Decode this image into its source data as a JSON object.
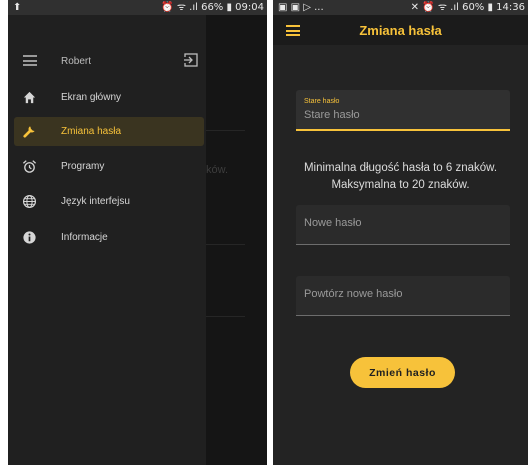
{
  "left_screen": {
    "status": {
      "left": "⬆",
      "right": "⏰ ᯤ .ıl 66% ▮ 09:04"
    },
    "drawer": {
      "user_name": "Robert",
      "items": [
        {
          "label": "Ekran główny",
          "icon": "home-icon",
          "active": false
        },
        {
          "label": "Zmiana hasła",
          "icon": "wrench-icon",
          "active": true
        },
        {
          "label": "Programy",
          "icon": "alarm-clock-icon",
          "active": false
        },
        {
          "label": "Język interfejsu",
          "icon": "globe-icon",
          "active": false
        },
        {
          "label": "Informacje",
          "icon": "info-icon",
          "active": false
        }
      ]
    },
    "behind_text": "ków."
  },
  "right_screen": {
    "status": {
      "left": "▣ ▣ ▷ ...",
      "right": "✕ ⏰ ᯤ .ıl 60% ▮ 14:36"
    },
    "title": "Zmiana hasła",
    "old_password": {
      "label": "Stare hasło",
      "placeholder": "Stare hasło"
    },
    "hint_line1": "Minimalna długość hasła to 6 znaków.",
    "hint_line2": "Maksymalna to 20 znaków.",
    "new_password": {
      "placeholder": "Nowe hasło"
    },
    "repeat_password": {
      "placeholder": "Powtórz nowe hasło"
    },
    "submit_label": "Zmień hasło"
  },
  "colors": {
    "accent": "#f7c23a",
    "background": "#232323",
    "drawer": "#202020",
    "active_item": "#3a3420"
  }
}
